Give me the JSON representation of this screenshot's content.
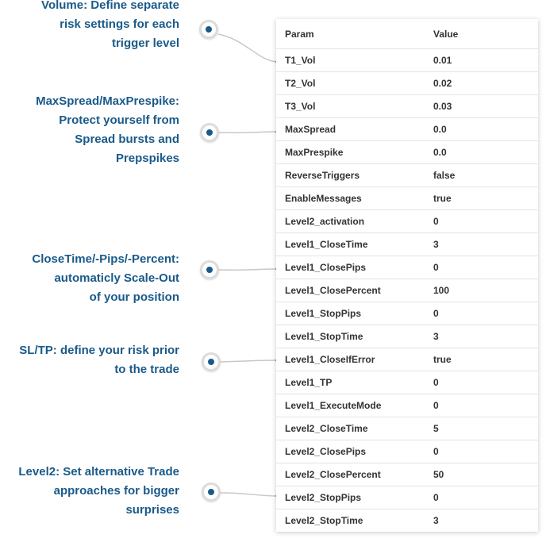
{
  "annotations": [
    {
      "lines": [
        "Volume: Define separate",
        "risk settings for each",
        "trigger level"
      ]
    },
    {
      "lines": [
        "MaxSpread/MaxPrespike:",
        "Protect yourself from",
        "Spread bursts and",
        "Prepspikes"
      ]
    },
    {
      "lines": [
        "CloseTime/-Pips/-Percent:",
        "automaticly Scale-Out",
        "of your position"
      ]
    },
    {
      "lines": [
        "SL/TP: define your risk prior",
        "to the trade"
      ]
    },
    {
      "lines": [
        "Level2: Set alternative Trade",
        "approaches for bigger",
        "surprises"
      ]
    }
  ],
  "table": {
    "headers": [
      "Param",
      "Value"
    ],
    "rows": [
      [
        "T1_Vol",
        "0.01"
      ],
      [
        "T2_Vol",
        "0.02"
      ],
      [
        "T3_Vol",
        "0.03"
      ],
      [
        "MaxSpread",
        "0.0"
      ],
      [
        "MaxPrespike",
        "0.0"
      ],
      [
        "ReverseTriggers",
        "false"
      ],
      [
        "EnableMessages",
        "true"
      ],
      [
        "Level2_activation",
        "0"
      ],
      [
        "Level1_CloseTime",
        "3"
      ],
      [
        "Level1_ClosePips",
        "0"
      ],
      [
        "Level1_ClosePercent",
        "100"
      ],
      [
        "Level1_StopPips",
        "0"
      ],
      [
        "Level1_StopTime",
        "3"
      ],
      [
        "Level1_CloseIfError",
        "true"
      ],
      [
        "Level1_TP",
        "0"
      ],
      [
        "Level1_ExecuteMode",
        "0"
      ],
      [
        "Level2_CloseTime",
        "5"
      ],
      [
        "Level2_ClosePips",
        "0"
      ],
      [
        "Level2_ClosePercent",
        "50"
      ],
      [
        "Level2_StopPips",
        "0"
      ],
      [
        "Level2_StopTime",
        "3"
      ]
    ]
  },
  "colors": {
    "accent": "#1a5a8a",
    "connector": "#c8c8c8",
    "marker_ring": "#dcdcdc",
    "row_border": "#e3e3e3"
  }
}
